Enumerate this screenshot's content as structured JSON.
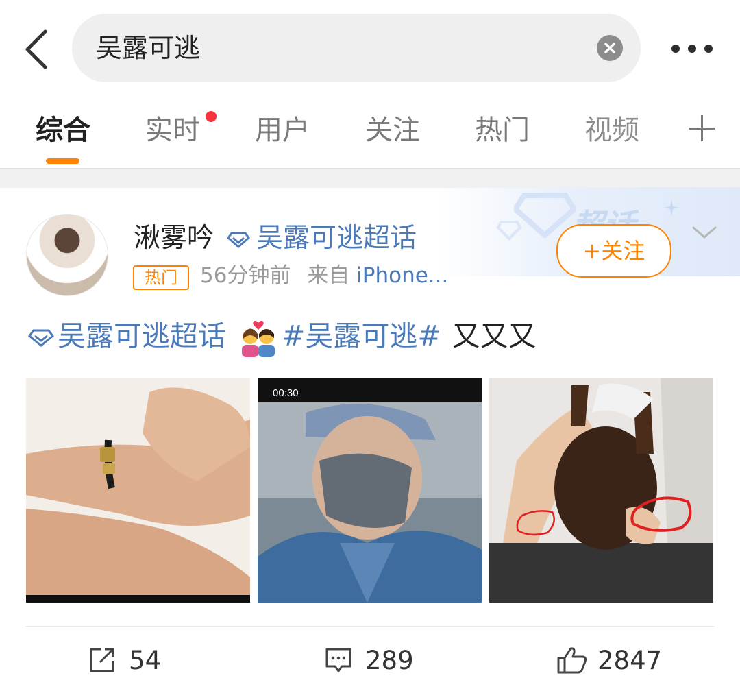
{
  "search": {
    "query": "吴露可逃"
  },
  "tabs": [
    "综合",
    "实时",
    "用户",
    "关注",
    "热门",
    "视频"
  ],
  "post": {
    "username": "湫雾吟",
    "supertopic": "吴露可逃超话",
    "hot_badge": "热门",
    "time": "56分钟前",
    "source_prefix": "来自",
    "source": "iPhone...",
    "follow_label": "+关注",
    "banner_text": "超话",
    "content": {
      "supertopic_link": "吴露可逃超话",
      "hashtag": "#吴露可逃#",
      "text": "又又又"
    },
    "images": [
      {
        "name": "bracelet-on-wrist"
      },
      {
        "name": "masked-man-screenshot",
        "status_time": "00:30"
      },
      {
        "name": "dog-held-with-annotations"
      }
    ]
  },
  "actions": {
    "reposts": "54",
    "comments": "289",
    "likes": "2847"
  },
  "colors": {
    "accent": "#ff8200",
    "link": "#4b7ab8",
    "red_dot": "#f6323b"
  }
}
